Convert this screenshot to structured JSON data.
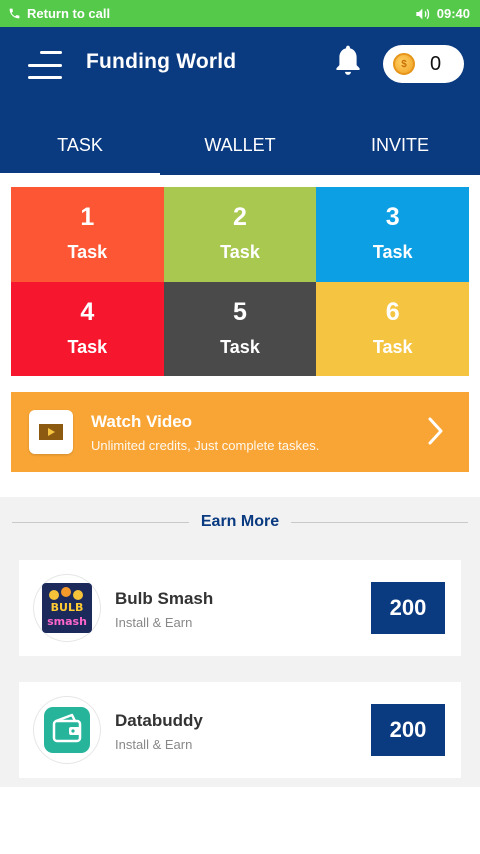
{
  "status_bar": {
    "call_text": "Return to call",
    "time": "09:40"
  },
  "header": {
    "title": "Funding World",
    "coin_count": "0"
  },
  "tabs": [
    {
      "label": "TASK",
      "active": true
    },
    {
      "label": "WALLET",
      "active": false
    },
    {
      "label": "INVITE",
      "active": false
    }
  ],
  "tasks": [
    {
      "number": "1",
      "label": "Task",
      "color": "#fd5634"
    },
    {
      "number": "2",
      "label": "Task",
      "color": "#a8c850"
    },
    {
      "number": "3",
      "label": "Task",
      "color": "#0d9fe3"
    },
    {
      "number": "4",
      "label": "Task",
      "color": "#f6172f"
    },
    {
      "number": "5",
      "label": "Task",
      "color": "#4a4a4a"
    },
    {
      "number": "6",
      "label": "Task",
      "color": "#f5c542"
    }
  ],
  "video_banner": {
    "title": "Watch Video",
    "subtitle": "Unlimited credits, Just complete taskes."
  },
  "earn_more": {
    "title": "Earn More",
    "apps": [
      {
        "name": "Bulb Smash",
        "subtitle": "Install & Earn",
        "reward": "200",
        "icon_text": "BULB smash"
      },
      {
        "name": "Databuddy",
        "subtitle": "Install & Earn",
        "reward": "200"
      }
    ]
  },
  "colors": {
    "primary": "#0a3a80",
    "status_bar": "#55c94a",
    "accent": "#f8a535"
  }
}
